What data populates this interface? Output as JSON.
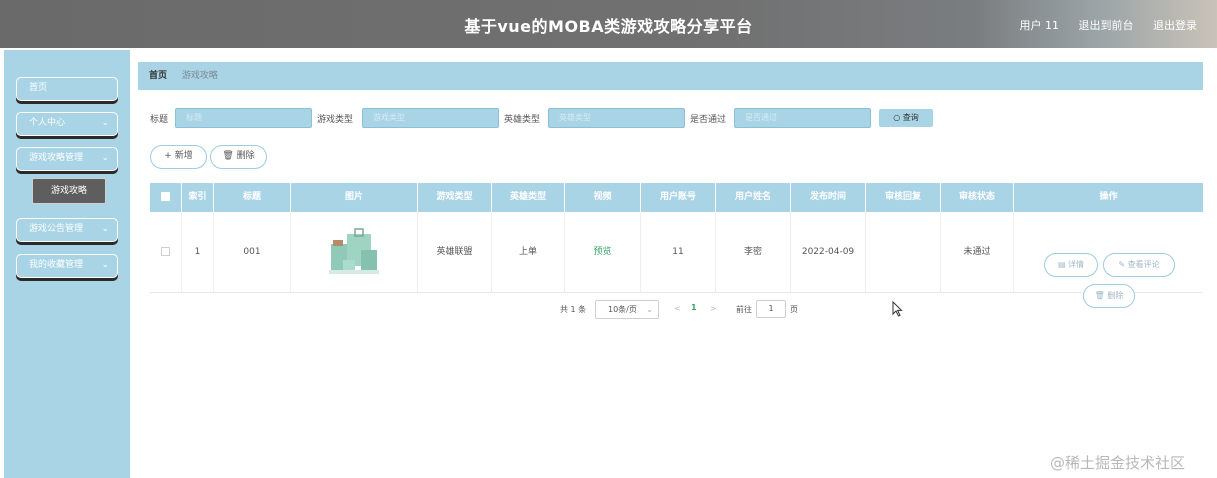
{
  "header": {
    "title": "基于vue的MOBA类游戏攻略分享平台",
    "user": "用户 11",
    "back_front": "退出到前台",
    "logout": "退出登录"
  },
  "sidebar": {
    "items": [
      {
        "label": "首页"
      },
      {
        "label": "个人中心"
      },
      {
        "label": "游戏攻略管理"
      },
      {
        "label": "游戏公告管理"
      },
      {
        "label": "我的收藏管理"
      }
    ],
    "sub_items": [
      {
        "label": "游戏攻略"
      }
    ]
  },
  "breadcrumb": {
    "home": "首页",
    "current": "游戏攻略"
  },
  "search": {
    "title_label": "标题",
    "title_placeholder": "标题",
    "game_type_label": "游戏类型",
    "game_type_placeholder": "游戏类型",
    "hero_type_label": "英雄类型",
    "hero_type_placeholder": "英雄类型",
    "passed_label": "是否通过",
    "passed_placeholder": "是否通过",
    "query_button": "○ 查询"
  },
  "actions": {
    "add": "+ 新增",
    "delete": "🗑 删除"
  },
  "table": {
    "columns": [
      "索引",
      "标题",
      "图片",
      "游戏类型",
      "英雄类型",
      "视频",
      "用户账号",
      "用户姓名",
      "发布时间",
      "审核回复",
      "审核状态",
      "操作"
    ],
    "rows": [
      {
        "index": "1",
        "title": "001",
        "game_type": "英雄联盟",
        "hero_type": "上单",
        "video": "预览",
        "account": "11",
        "name": "李密",
        "date": "2022-04-09",
        "review_reply": "",
        "review_status": "未通过",
        "ops": {
          "detail": "详情",
          "comments": "查看评论",
          "delete": "删除"
        }
      }
    ]
  },
  "pagination": {
    "total": "共 1 条",
    "page_size": "10条/页",
    "prev": "<",
    "current_page": "1",
    "next": ">",
    "goto_label": "前往",
    "goto_value": "1",
    "page_suffix": "页"
  },
  "watermark": "@稀土掘金技术社区",
  "colors": {
    "accent": "#a9d4e6",
    "header_bg": "#717171",
    "active_menu": "#5e5e5e",
    "link_green": "#3aa56b"
  }
}
